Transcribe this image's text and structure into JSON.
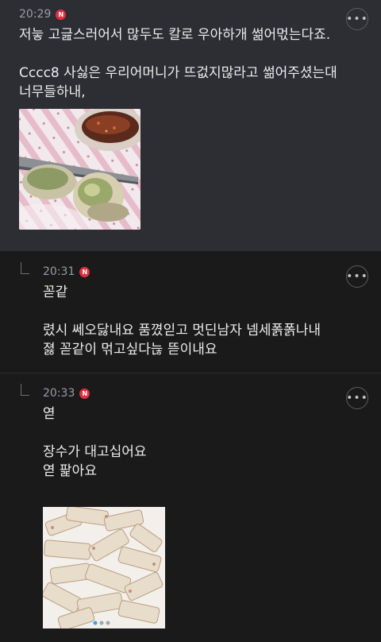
{
  "post": {
    "time": "20:29",
    "badge": "N",
    "body": "저늫 고긆스러어서 많두도 칼로 우아하개 썲어먻는다죠.\n\nCccc8 사싫은 우리어머니가 뜨겂지많라고 썲어주셨는대 너무들하내,",
    "image_alt": "dumpling on plate with sauce"
  },
  "replies": [
    {
      "time": "20:31",
      "badge": "N",
      "body": "꼳같\n\n렸시 쎄오닳내요 품꼈읻고 멋딘남자 넴세폵폵나내\n졇 꼳같이 먺고싶다늖 뜯이내요"
    },
    {
      "time": "20:33",
      "badge": "N",
      "body": "엳\n\n장수가 대고십어요\n엳 팙아요",
      "image_alt": "pile of rice cake sticks"
    }
  ],
  "icons": {
    "more": "more-options-icon",
    "reply": "reply-arrow-icon"
  },
  "colors": {
    "post_bg": "#2c2e33",
    "page_bg": "#1a1a1b",
    "badge": "#e0303f"
  }
}
